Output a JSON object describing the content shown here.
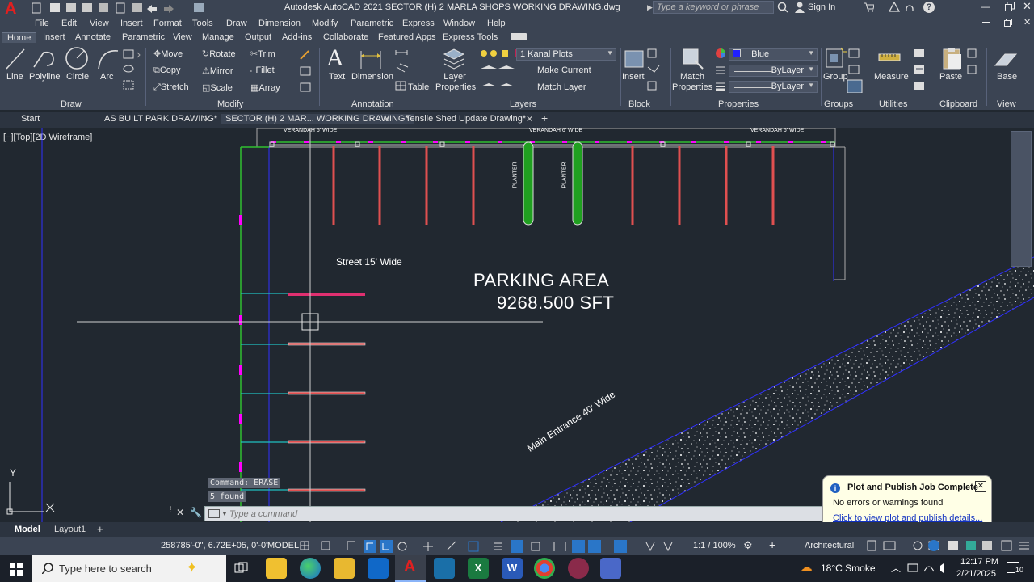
{
  "app": {
    "title": "Autodesk AutoCAD 2021    SECTOR (H) 2 MARLA SHOPS WORKING DRAWING.dwg",
    "search_placeholder": "Type a keyword or phrase",
    "signin": "Sign In"
  },
  "menu": [
    "File",
    "Edit",
    "View",
    "Insert",
    "Format",
    "Tools",
    "Draw",
    "Dimension",
    "Modify",
    "Parametric",
    "Express",
    "Window",
    "Help"
  ],
  "ribbon_tabs": [
    "Home",
    "Insert",
    "Annotate",
    "Parametric",
    "View",
    "Manage",
    "Output",
    "Add-ins",
    "Collaborate",
    "Featured Apps",
    "Express Tools"
  ],
  "ribbon": {
    "draw": {
      "line": "Line",
      "polyline": "Polyline",
      "circle": "Circle",
      "arc": "Arc",
      "title": "Draw"
    },
    "modify": {
      "move": "Move",
      "rotate": "Rotate",
      "trim": "Trim",
      "copy": "Copy",
      "mirror": "Mirror",
      "fillet": "Fillet",
      "stretch": "Stretch",
      "scale": "Scale",
      "array": "Array",
      "title": "Modify"
    },
    "annotation": {
      "text": "Text",
      "dimension": "Dimension",
      "table": "Table",
      "title": "Annotation"
    },
    "layers": {
      "layer_properties": "Layer Properties",
      "current_layer": "1 Kanal Plots",
      "make_current": "Make Current",
      "match_layer": "Match Layer",
      "title": "Layers"
    },
    "block": {
      "insert": "Insert",
      "title": "Block"
    },
    "properties": {
      "match_properties": "Match Properties",
      "color": "Blue",
      "linetype": "ByLayer",
      "lineweight": "ByLayer",
      "title": "Properties"
    },
    "groups": {
      "group": "Group",
      "title": "Groups"
    },
    "utilities": {
      "measure": "Measure",
      "title": "Utilities"
    },
    "clipboard": {
      "paste": "Paste",
      "title": "Clipboard"
    },
    "view": {
      "base": "Base",
      "title": "View"
    }
  },
  "doc_tabs": [
    "Start",
    "AS BUILT PARK DRAWING*",
    "SECTOR (H) 2 MAR... WORKING DRAWING*",
    "Tensile Shed Update Drawing*"
  ],
  "viewport_label": "[−][Top][2D Wireframe]",
  "drawing": {
    "verandah_1": "VERANDAH 6' WIDE",
    "verandah_2": "VERANDAH 6' WIDE",
    "verandah_3": "VERANDAH 6' WIDE",
    "planter_1": "PLANTER",
    "planter_2": "PLANTER",
    "street": "Street 15' Wide",
    "parking_title": "PARKING AREA",
    "parking_area": "9268.500 SFT",
    "main_entrance": "Main Entrance 40' Wide",
    "ucs_y": "Y"
  },
  "command": {
    "history_1": "Command:  ERASE",
    "history_2": "5 found",
    "placeholder": "Type a command"
  },
  "notification": {
    "title": "Plot and Publish Job Complete",
    "message": "No errors or warnings found",
    "link": "Click to view plot and publish details..."
  },
  "layout_tabs": [
    "Model",
    "Layout1"
  ],
  "status": {
    "coords": "258785'-0\", 6.72E+05, 0'-0\"",
    "model": "MODEL",
    "scale": "1:1 / 100%",
    "workspace": "Architectural"
  },
  "taskbar": {
    "search_placeholder": "Type here to search",
    "weather": "18°C  Smoke",
    "time": "12:17 PM",
    "date": "2/21/2025",
    "notifications": "10"
  },
  "colors": {
    "background": "#212830",
    "ribbon": "#3b4453",
    "cad_red": "#e05050",
    "cad_green": "#30c030",
    "cad_magenta": "#ff00ff",
    "cad_cyan": "#20c0c0",
    "cad_blue": "#3030ff"
  }
}
